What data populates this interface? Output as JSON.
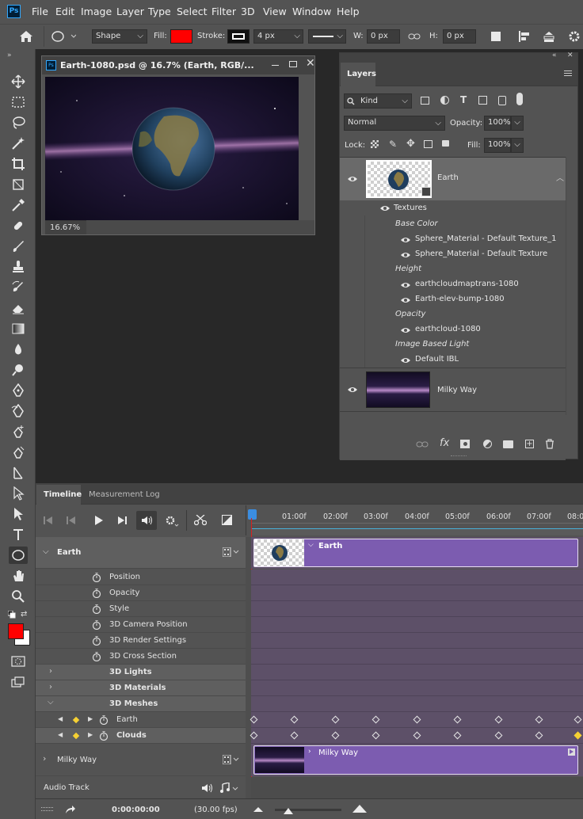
{
  "app": {
    "logo": "Ps"
  },
  "menu": [
    "File",
    "Edit",
    "Image",
    "Layer",
    "Type",
    "Select",
    "Filter",
    "3D",
    "View",
    "Window",
    "Help"
  ],
  "options": {
    "home_icon": "home-icon",
    "shape_icon": "ellipse-icon",
    "mode": "Shape",
    "fill_label": "Fill:",
    "fill_color": "#ff0000",
    "stroke_label": "Stroke:",
    "stroke_width": "4 px",
    "w_label": "W:",
    "w_value": "0 px",
    "h_label": "H:",
    "h_value": "0 px"
  },
  "document": {
    "title": "Earth-1080.psd @ 16.7% (Earth, RGB/...",
    "zoom": "16.67%"
  },
  "layers": {
    "tab": "Layers",
    "kind": "Kind",
    "blend": "Normal",
    "opacity_label": "Opacity:",
    "opacity": "100%",
    "lock_label": "Lock:",
    "fill_label": "Fill:",
    "fill": "100%",
    "earth": "Earth",
    "textures": "Textures",
    "groups": [
      {
        "heading": "Base Color",
        "items": [
          "Sphere_Material - Default Texture_1",
          "Sphere_Material - Default Texture"
        ]
      },
      {
        "heading": "Height",
        "items": [
          "earthcloudmaptrans-1080",
          "Earth-elev-bump-1080"
        ]
      },
      {
        "heading": "Opacity",
        "items": [
          "earthcloud-1080"
        ]
      },
      {
        "heading": "Image Based Light",
        "items": [
          "Default IBL"
        ]
      }
    ],
    "milkyway": "Milky Way"
  },
  "timeline": {
    "tab_active": "Timeline",
    "tab_other": "Measurement Log",
    "ticks": [
      "01:00f",
      "02:00f",
      "03:00f",
      "04:00f",
      "05:00f",
      "06:00f",
      "07:00f",
      "08:0"
    ],
    "earth_group": "Earth",
    "properties": [
      "Position",
      "Opacity",
      "Style",
      "3D Camera Position",
      "3D Render Settings",
      "3D Cross Section"
    ],
    "sections": [
      "3D Lights",
      "3D Materials",
      "3D Meshes"
    ],
    "meshes": [
      "Earth",
      "Clouds"
    ],
    "milky_way": "Milky Way",
    "audio": "Audio Track",
    "clip_earth": "Earth",
    "clip_milky": "Milky Way",
    "timecode": "0:00:00:00",
    "fps": "(30.00 fps)"
  }
}
